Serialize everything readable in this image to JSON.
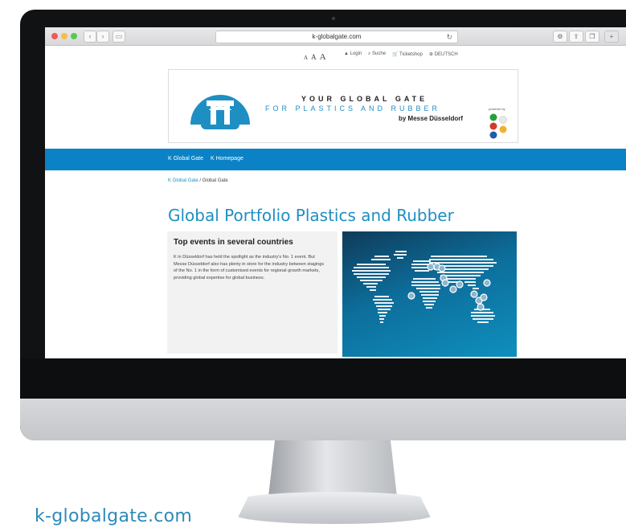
{
  "browser": {
    "url": "k-globalgate.com"
  },
  "utility_bar": {
    "font_sizes": "A A A",
    "login": "Login",
    "search": "Suche",
    "ticketshop": "Ticketshop",
    "language": "DEUTSCH"
  },
  "banner": {
    "tagline_1": "YOUR GLOBAL GATE",
    "tagline_2": "FOR PLASTICS AND RUBBER",
    "tagline_3": "by Messe Düsseldorf",
    "powered_by": "powered by"
  },
  "main_nav": {
    "items": [
      "K Global Gate",
      "K Homepage"
    ]
  },
  "breadcrumb": {
    "link": "K Global Gate",
    "separator": "/",
    "current": "Global Gate"
  },
  "page": {
    "title": "Global Portfolio Plastics and Rubber",
    "section_heading": "Top events in several countries",
    "section_text": "K in Düsseldorf has held the spotlight as the industry's No. 1 event. But Messe Düsseldorf also has plenty in store for the industry between stagings of the No. 1 in the form of customised events for regional growth markets, providing global expertise for global business."
  },
  "footer_caption": "k-globalgate.com",
  "colors": {
    "brand_blue": "#1e8fc3",
    "nav_blue": "#0b82c6"
  }
}
